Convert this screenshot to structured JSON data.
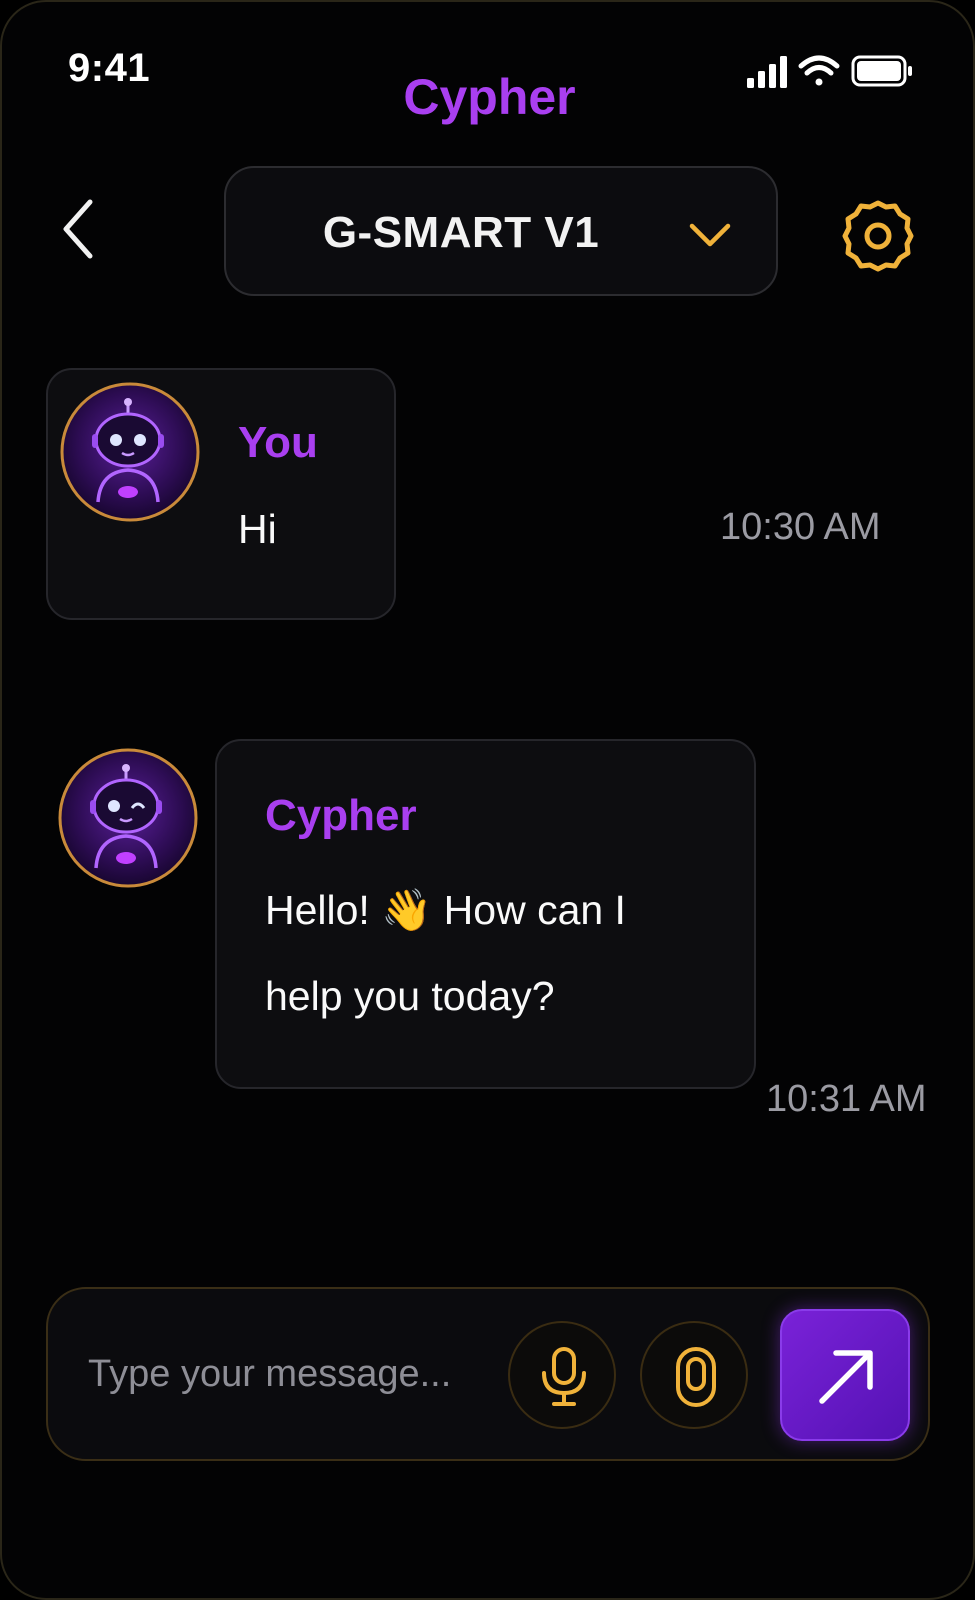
{
  "status_bar": {
    "time": "9:41",
    "icons": [
      "signal-icon",
      "wifi-icon",
      "battery-icon"
    ]
  },
  "header": {
    "title": "Cypher",
    "back_icon": "chevron-left-icon",
    "model": "G-SMART V1",
    "dropdown_icon": "chevron-down-icon",
    "settings_icon": "gear-icon"
  },
  "messages": [
    {
      "sender": "You",
      "text": "Hi",
      "time": "10:30 AM",
      "avatar": "robot-avatar-icon"
    },
    {
      "sender": "Cypher",
      "text_line1": "Hello! 👋 How can I",
      "text_line2": "help you today?",
      "time": "10:31 AM",
      "avatar": "robot-avatar-icon"
    }
  ],
  "composer": {
    "placeholder": "Type your message...",
    "voice_icon": "microphone-icon",
    "attach_icon": "mic-capsule-icon",
    "send_icon": "send-arrow-icon"
  },
  "colors": {
    "accent_purple": "#a93ff0",
    "accent_gold": "#f0b23a",
    "background": "#030304",
    "send_button": "#6a1bcc"
  }
}
